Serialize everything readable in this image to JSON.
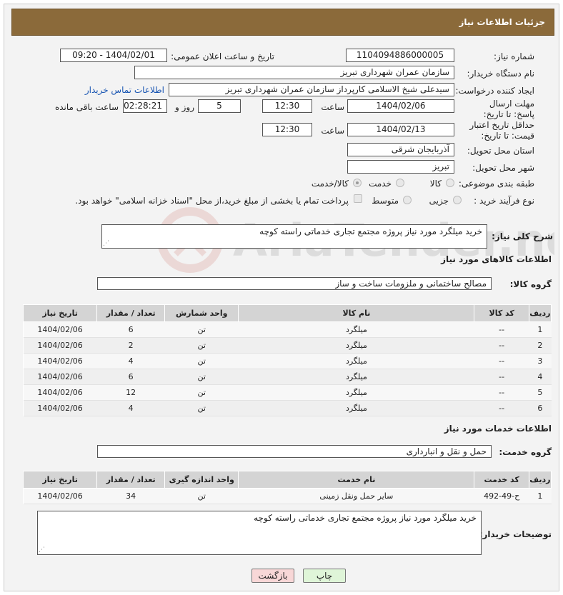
{
  "header": {
    "title": "جزئیات اطلاعات نیاز"
  },
  "fields": {
    "need_number_label": "شماره نیاز:",
    "need_number": "1104094886000005",
    "announce_label": "تاریخ و ساعت اعلان عمومی:",
    "announce_value": "1404/02/01 - 09:20",
    "buyer_org_label": "نام دستگاه خریدار:",
    "buyer_org": "سازمان عمران شهرداری تبریز",
    "requester_label": "ایجاد کننده درخواست:",
    "requester": "سیدعلی شیخ الاسلامی کارپرداز سازمان عمران شهرداری تبریز",
    "contact_link": "اطلاعات تماس خریدار",
    "reply_deadline_label": "مهلت ارسال پاسخ: تا تاریخ:",
    "reply_date": "1404/02/06",
    "time_label": "ساعت",
    "reply_time": "12:30",
    "days": "5",
    "days_label": "روز و",
    "remaining": "02:28:21",
    "remaining_label": "ساعت باقی مانده",
    "price_validity_label": "حداقل تاریخ اعتبار قیمت: تا تاریخ:",
    "price_date": "1404/02/13",
    "price_time": "12:30",
    "province_label": "استان محل تحویل:",
    "province": "آذربایجان شرقی",
    "city_label": "شهر محل تحویل:",
    "city": "تبریز",
    "category_label": "طبقه بندی موضوعی:",
    "category_options": [
      "کالا",
      "خدمت",
      "کالا/خدمت"
    ],
    "process_label": "نوع فرآیند خرید :",
    "process_options": [
      "جزیی",
      "متوسط"
    ],
    "payment_note": "پرداخت تمام یا بخشی از مبلغ خرید،از محل \"اسناد خزانه اسلامی\" خواهد بود."
  },
  "summary": {
    "label": "شرح کلی نیاز:",
    "text": "خرید میلگرد مورد نیاز پروژه مجتمع تجاری خدماتی راسته کوچه"
  },
  "goods": {
    "section_title": "اطلاعات کالاهای مورد نیاز",
    "group_label": "گروه کالا:",
    "group_value": "مصالح ساختمانی و ملزومات ساخت و ساز",
    "columns": [
      "ردیف",
      "کد کالا",
      "نام کالا",
      "واحد شمارش",
      "تعداد / مقدار",
      "تاریخ نیاز"
    ],
    "rows": [
      [
        "1",
        "--",
        "میلگرد",
        "تن",
        "6",
        "1404/02/06"
      ],
      [
        "2",
        "--",
        "میلگرد",
        "تن",
        "2",
        "1404/02/06"
      ],
      [
        "3",
        "--",
        "میلگرد",
        "تن",
        "4",
        "1404/02/06"
      ],
      [
        "4",
        "--",
        "میلگرد",
        "تن",
        "6",
        "1404/02/06"
      ],
      [
        "5",
        "--",
        "میلگرد",
        "تن",
        "12",
        "1404/02/06"
      ],
      [
        "6",
        "--",
        "میلگرد",
        "تن",
        "4",
        "1404/02/06"
      ]
    ]
  },
  "services": {
    "section_title": "اطلاعات خدمات مورد نیاز",
    "group_label": "گروه خدمت:",
    "group_value": "حمل و نقل و انبارداری",
    "columns": [
      "ردیف",
      "کد خدمت",
      "نام خدمت",
      "واحد اندازه گیری",
      "تعداد / مقدار",
      "تاریخ نیاز"
    ],
    "rows": [
      [
        "1",
        "ح-49-492",
        "سایر حمل ونقل زمینی",
        "تن",
        "34",
        "1404/02/06"
      ]
    ]
  },
  "buyer_notes": {
    "label": "توضیحات خریدار:",
    "text": "خرید میلگرد مورد نیاز پروژه مجتمع تجاری خدماتی راسته کوچه"
  },
  "buttons": {
    "print": "چاپ",
    "back": "بازگشت"
  },
  "watermark": "AriaTender.net",
  "colors": {
    "header_bg": "#8b6a3a",
    "link": "#1a56b3",
    "back_button_bg": "#f8d7d7",
    "print_button_bg": "#dff5d8"
  }
}
